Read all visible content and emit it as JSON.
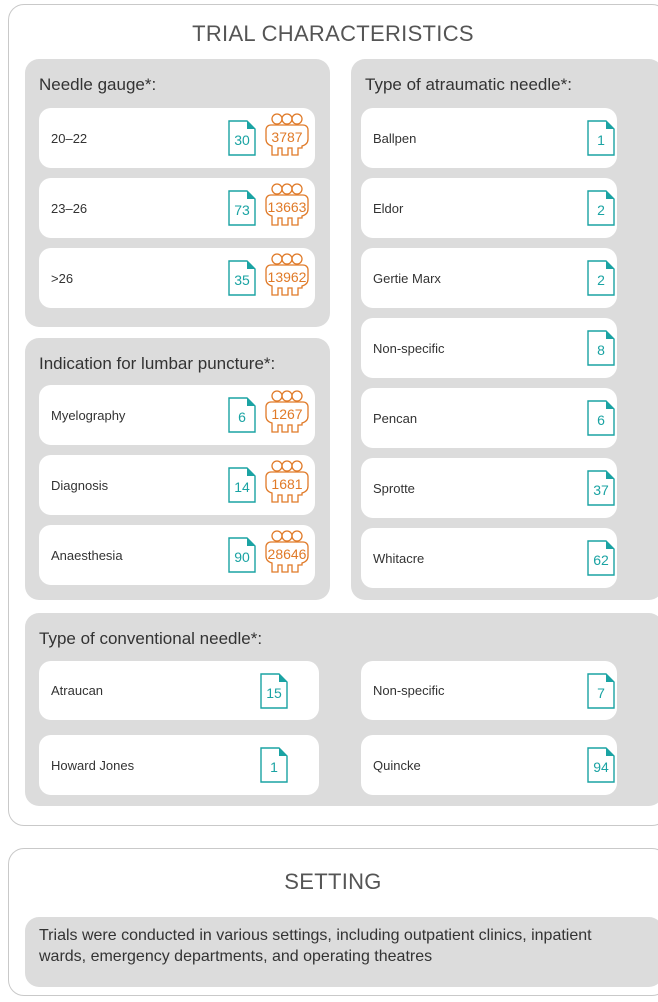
{
  "trial": {
    "title": "TRIAL CHARACTERISTICS",
    "needle_gauge": {
      "title": "Needle gauge*:",
      "rows": [
        {
          "label": "20–22",
          "trials": "30",
          "participants": "3787"
        },
        {
          "label": "23–26",
          "trials": "73",
          "participants": "13663"
        },
        {
          "label": ">26",
          "trials": "35",
          "participants": "13962"
        }
      ]
    },
    "indication": {
      "title": "Indication for lumbar puncture*:",
      "rows": [
        {
          "label": "Myelography",
          "trials": "6",
          "participants": "1267"
        },
        {
          "label": "Diagnosis",
          "trials": "14",
          "participants": "1681"
        },
        {
          "label": "Anaesthesia",
          "trials": "90",
          "participants": "28646"
        }
      ]
    },
    "atraumatic": {
      "title": "Type of atraumatic needle*:",
      "rows": [
        {
          "label": "Ballpen",
          "trials": "1"
        },
        {
          "label": "Eldor",
          "trials": "2"
        },
        {
          "label": "Gertie Marx",
          "trials": "2"
        },
        {
          "label": "Non-specific",
          "trials": "8"
        },
        {
          "label": "Pencan",
          "trials": "6"
        },
        {
          "label": "Sprotte",
          "trials": "37"
        },
        {
          "label": "Whitacre",
          "trials": "62"
        }
      ]
    },
    "conventional": {
      "title": "Type of conventional needle*:",
      "rows": [
        {
          "label": "Atraucan",
          "trials": "15"
        },
        {
          "label": "Howard Jones",
          "trials": "1"
        },
        {
          "label": "Non-specific",
          "trials": "7"
        },
        {
          "label": "Quincke",
          "trials": "94"
        }
      ]
    }
  },
  "setting": {
    "title": "SETTING",
    "text": "Trials were conducted in various settings, including outpatient clinics, inpatient wards, emergency departments, and operating theatres"
  },
  "colors": {
    "panel_bg": "#dcdcdc",
    "trials_teal": "#1aa3a3",
    "participants_orange": "#e07a28"
  },
  "icons": {
    "trials": "document-icon",
    "participants": "people-group-icon"
  }
}
